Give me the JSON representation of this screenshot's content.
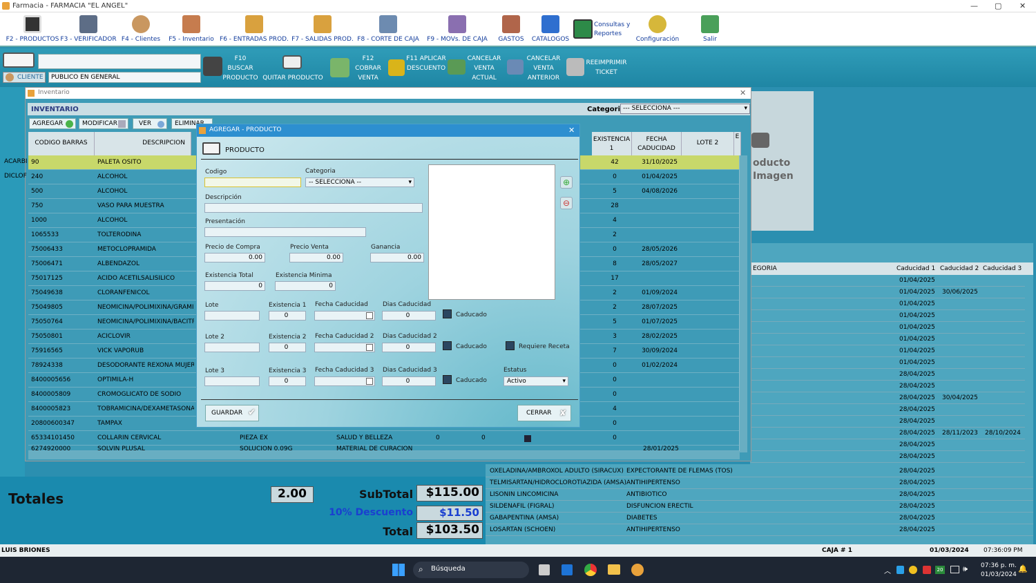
{
  "window": {
    "title": "Farmacia  -  FARMACIA \"EL ANGEL\""
  },
  "toolbar": [
    {
      "label": "F2 - PRODUCTOS",
      "icon": "barcode-icon"
    },
    {
      "label": "F3 - VERIFICADOR",
      "icon": "scanner-icon"
    },
    {
      "label": "F4 - Clientes",
      "icon": "clients-icon"
    },
    {
      "label": "F5 - Inventario",
      "icon": "inventory-icon"
    },
    {
      "label": "F6 - ENTRADAS PROD.",
      "icon": "box-in-icon"
    },
    {
      "label": "F7 - SALIDAS PROD.",
      "icon": "box-out-icon"
    },
    {
      "label": "F8 - CORTE DE CAJA",
      "icon": "cash-icon"
    },
    {
      "label": "F9 - MOVs. DE CAJA",
      "icon": "cash-movements-icon"
    },
    {
      "label": "GASTOS",
      "icon": "expenses-icon"
    },
    {
      "label": "CATALOGOS",
      "icon": "catalog-icon"
    },
    {
      "label": "Consultas y Reportes",
      "icon": "reports-icon"
    },
    {
      "label": "Configuración",
      "icon": "gear-icon"
    },
    {
      "label": "Salir",
      "icon": "exit-icon"
    }
  ],
  "bar2": {
    "cliente_label": "CLIENTE",
    "cliente_value": "PUBLICO EN GENERAL",
    "buttons": [
      {
        "label": "F10 BUSCAR PRODUCTO"
      },
      {
        "label": "QUITAR PRODUCTO"
      },
      {
        "label": "F12 COBRAR VENTA"
      },
      {
        "label": "F11 APLICAR DESCUENTO"
      },
      {
        "label": "CANCELAR VENTA ACTUAL"
      },
      {
        "label": "CANCELAR VENTA ANTERIOR"
      },
      {
        "label": "REEIMPRIMIR TICKET"
      }
    ]
  },
  "inventory": {
    "window_title": "Inventario",
    "header": "INVENTARIO",
    "categoria_label": "Categoria",
    "categoria_value": "--- SELECCIONA ---",
    "buttons": [
      "AGREGAR",
      "MODIFICAR",
      "VER",
      "ELIMINAR",
      "CERRAR"
    ],
    "columns": [
      "CODIGO BARRAS",
      "DESCRIPCION",
      "EXISTENCIA 1",
      "FECHA CADUCIDAD",
      "LOTE 2",
      "E"
    ],
    "left_labels": [
      "ACARBI",
      "DICLOF"
    ],
    "rows": [
      {
        "code": "90",
        "desc": "PALETA OSITO",
        "ex": "42",
        "fecha": "31/10/2025"
      },
      {
        "code": "240",
        "desc": "ALCOHOL",
        "ex": "0",
        "fecha": "01/04/2025"
      },
      {
        "code": "500",
        "desc": "ALCOHOL",
        "ex": "5",
        "fecha": "04/08/2026"
      },
      {
        "code": "750",
        "desc": "VASO PARA MUESTRA",
        "ex": "28",
        "fecha": ""
      },
      {
        "code": "1000",
        "desc": "ALCOHOL",
        "ex": "4",
        "fecha": ""
      },
      {
        "code": "1065533",
        "desc": "TOLTERODINA",
        "ex": "2",
        "fecha": ""
      },
      {
        "code": "75006433",
        "desc": "METOCLOPRAMIDA",
        "ex": "0",
        "fecha": "28/05/2026"
      },
      {
        "code": "75006471",
        "desc": "ALBENDAZOL",
        "ex": "8",
        "fecha": "28/05/2027"
      },
      {
        "code": "75017125",
        "desc": "ACIDO ACETILSALISILICO",
        "ex": "17",
        "fecha": ""
      },
      {
        "code": "75049638",
        "desc": "CLORANFENICOL",
        "ex": "2",
        "fecha": "01/09/2024"
      },
      {
        "code": "75049805",
        "desc": "NEOMICINA/POLIMIXINA/GRAMICI",
        "ex": "2",
        "fecha": "28/07/2025"
      },
      {
        "code": "75050764",
        "desc": "NEOMICINA/POLIMIXINA/BACITRA",
        "ex": "5",
        "fecha": "01/07/2025"
      },
      {
        "code": "75050801",
        "desc": "ACICLOVIR",
        "ex": "3",
        "fecha": "28/02/2025"
      },
      {
        "code": "75916565",
        "desc": "VICK VAPORUB",
        "ex": "7",
        "fecha": "30/09/2024"
      },
      {
        "code": "78924338",
        "desc": "DESODORANTE REXONA MUJER",
        "ex": "0",
        "fecha": "01/02/2024"
      },
      {
        "code": "8400005656",
        "desc": "OPTIMILA-H",
        "ex": "0",
        "fecha": ""
      },
      {
        "code": "8400005809",
        "desc": "CROMOGLICATO DE SODIO",
        "ex": "0",
        "fecha": ""
      },
      {
        "code": "8400005823",
        "desc": "TOBRAMICINA/DEXAMETASONA",
        "ex": "4",
        "fecha": ""
      },
      {
        "code": "20800600347",
        "desc": "TAMPAX",
        "ex": "0",
        "fecha": ""
      },
      {
        "code": "65334101450",
        "desc": "COLLARIN CERVICAL",
        "ex": "0",
        "fecha": "",
        "extra1": "PIEZA EX",
        "extra2": "SALUD Y BELLEZA",
        "extra3": "0",
        "extra4": "0"
      }
    ],
    "partial_row": {
      "code": "6274920000",
      "desc": "SOLVIN PLUSAL",
      "extra1": "SOLUCION 0.09G",
      "extra2": "MATERIAL DE CURACION",
      "fecha": "28/01/2025"
    }
  },
  "image_panel": {
    "text1": "oducto",
    "text2": "Imagen"
  },
  "right_table": {
    "columns": [
      "EGORIA",
      "Caducidad 1",
      "Caducidad 2",
      "Caducidad 3"
    ],
    "rows": [
      [
        "01/04/2025",
        "",
        ""
      ],
      [
        "01/04/2025",
        "30/06/2025",
        ""
      ],
      [
        "01/04/2025",
        "",
        ""
      ],
      [
        "01/04/2025",
        "",
        ""
      ],
      [
        "01/04/2025",
        "",
        ""
      ],
      [
        "01/04/2025",
        "",
        ""
      ],
      [
        "01/04/2025",
        "",
        ""
      ],
      [
        "01/04/2025",
        "",
        ""
      ],
      [
        "28/04/2025",
        "",
        ""
      ],
      [
        "28/04/2025",
        "",
        ""
      ],
      [
        "28/04/2025",
        "30/04/2025",
        ""
      ],
      [
        "28/04/2025",
        "",
        ""
      ],
      [
        "28/04/2025",
        "",
        ""
      ],
      [
        "28/04/2025",
        "28/11/2023",
        "28/10/2024"
      ],
      [
        "28/04/2025",
        "",
        ""
      ],
      [
        "28/04/2025",
        "",
        ""
      ]
    ],
    "bottom_rows": [
      {
        "prod": "OXELADINA/AMBROXOL ADULTO (SIRACUX)",
        "cat": "EXPECTORANTE DE FLEMAS (TOS)",
        "cad": "28/04/2025"
      },
      {
        "prod": "TELMISARTAN/HIDROCLOROTIAZIDA (AMSA)",
        "cat": "ANTIHIPERTENSO",
        "cad": "28/04/2025"
      },
      {
        "prod": "LISONIN LINCOMICINA",
        "cat": "ANTIBIOTICO",
        "cad": "28/04/2025"
      },
      {
        "prod": "SILDENAFIL (FIGRAL)",
        "cat": "DISFUNCION ERECTIL",
        "cad": "28/04/2025"
      },
      {
        "prod": "GABAPENTINA (AMSA)",
        "cat": "DIABETES",
        "cad": "28/04/2025"
      },
      {
        "prod": "LOSARTAN (SCHOEN)",
        "cat": "ANTIHIPERTENSO",
        "cad": "28/04/2025"
      }
    ]
  },
  "dialog": {
    "title": "AGREGAR - PRODUCTO",
    "header": "PRODUCTO",
    "codigo_label": "Codigo",
    "categoria_label": "Categoria",
    "categoria_value": "-- SELECCIONA --",
    "descripcion_label": "Descripción",
    "presentacion_label": "Presentación",
    "precio_compra_label": "Precio de Compra",
    "precio_compra": "0.00",
    "precio_venta_label": "Precio Venta",
    "precio_venta": "0.00",
    "ganancia_label": "Ganancia",
    "ganancia": "0.00",
    "existencia_total_label": "Existencia Total",
    "existencia_total": "0",
    "existencia_minima_label": "Existencia Minima",
    "existencia_minima": "0",
    "lote1_label": "Lote",
    "ex1_label": "Existencia 1",
    "fc1_label": "Fecha Caducidad",
    "dc1_label": "Dias Caducidad",
    "lote2_label": "Lote 2",
    "ex2_label": "Existencia 2",
    "fc2_label": "Fecha Caducidad 2",
    "dc2_label": "Dias Caducidad 2",
    "lote3_label": "Lote 3",
    "ex3_label": "Existencia 3",
    "fc3_label": "Fecha Caducidad 3",
    "dc3_label": "Dias Caducidad 3",
    "zero": "0",
    "caducado": "Caducado",
    "requiere_receta": "Requiere Receta",
    "estatus_label": "Estatus",
    "estatus_value": "Activo",
    "guardar": "GUARDAR",
    "cerrar": "CERRAR"
  },
  "totals": {
    "label": "Totales",
    "qty": "2.00",
    "subtotal_label": "SubTotal",
    "subtotal": "$115.00",
    "descuento_label": "10% Descuento",
    "descuento": "$11.50",
    "total_label": "Total",
    "total": "$103.50"
  },
  "status": {
    "user": "LUIS BRIONES",
    "caja": "CAJA # 1",
    "date": "01/03/2024",
    "time": "07:36:09 PM"
  },
  "taskbar": {
    "search": "Búsqueda",
    "time": "07:36 p. m.",
    "date": "01/03/2024",
    "badge": "20"
  }
}
